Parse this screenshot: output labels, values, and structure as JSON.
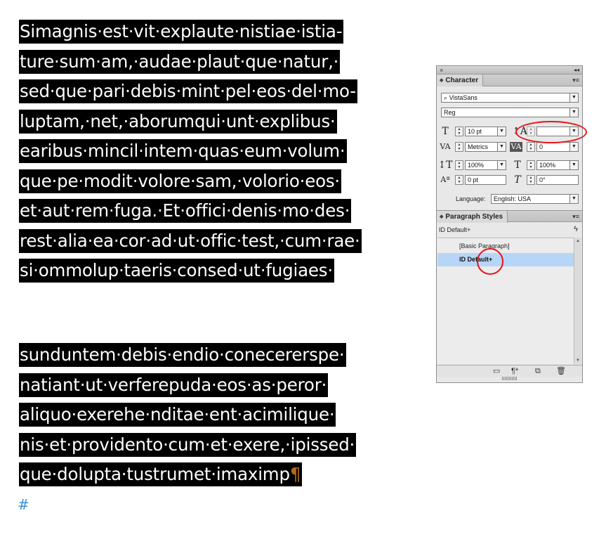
{
  "document": {
    "paragraph1": [
      "Simagnis·est·vit·explaute·nistiae·istia-",
      "ture·sum·am,·audae·plaut·que·natur,·",
      "sed·que·pari·debis·mint·pel·eos·del·mo-",
      "luptam,·net,·aborumqui·unt·explibus·",
      "earibus·mincil·intem·quas·eum·volum·",
      "que·pe·modit·volore·sam,·volorio·eos·",
      "et·aut·rem·fuga.·Et·offici·denis·mo·des·",
      "rest·alia·ea·cor·ad·ut·offic·test,·cum·rae·",
      "si·ommolup·taeris·consed·ut·fugiaes·"
    ],
    "paragraph2": [
      "sunduntem·debis·endio·conecererspe·",
      "natiant·ut·verferepuda·eos·as·peror·",
      "aliquo·exerehe·nditae·ent·acimilique·",
      "nis·et·providento·cum·et·exere,·ipissed·",
      "que·dolupta·tustrumet·imaximp"
    ],
    "pilcrow": "¶",
    "end_of_story": "#"
  },
  "panel": {
    "close_glyph": "×",
    "collapse_glyph": "◂◂",
    "character_tab": "Character",
    "menu_glyph": "▾≡",
    "font_family": "VistaSans",
    "font_style": "Reg",
    "font_size": "10 pt",
    "leading": "",
    "kerning": "Metrics",
    "tracking": "0",
    "vertical_scale": "100%",
    "horizontal_scale": "100%",
    "baseline_shift": "0 pt",
    "skew": "0°",
    "language_label": "Language:",
    "language": "English: USA",
    "paragraph_styles_tab": "Paragraph Styles",
    "current_style": "ID Default+",
    "styles": [
      "[Basic Paragraph]",
      "ID Default+"
    ],
    "selected_style": "ID Default+"
  },
  "icons": {
    "font_size": "font-size-icon",
    "leading": "leading-icon",
    "kerning": "kerning-icon",
    "tracking": "tracking-icon",
    "vertical_scale": "vertical-scale-icon",
    "horizontal_scale": "horizontal-scale-icon",
    "baseline_shift": "baseline-shift-icon",
    "skew": "skew-icon"
  },
  "colors": {
    "highlight": "#000000",
    "text": "#ffffff",
    "pilcrow": "#b06a1b",
    "end_mark": "#3a8fd6",
    "selection": "#b7d5f7",
    "annotation_ring": "#e4141b"
  }
}
